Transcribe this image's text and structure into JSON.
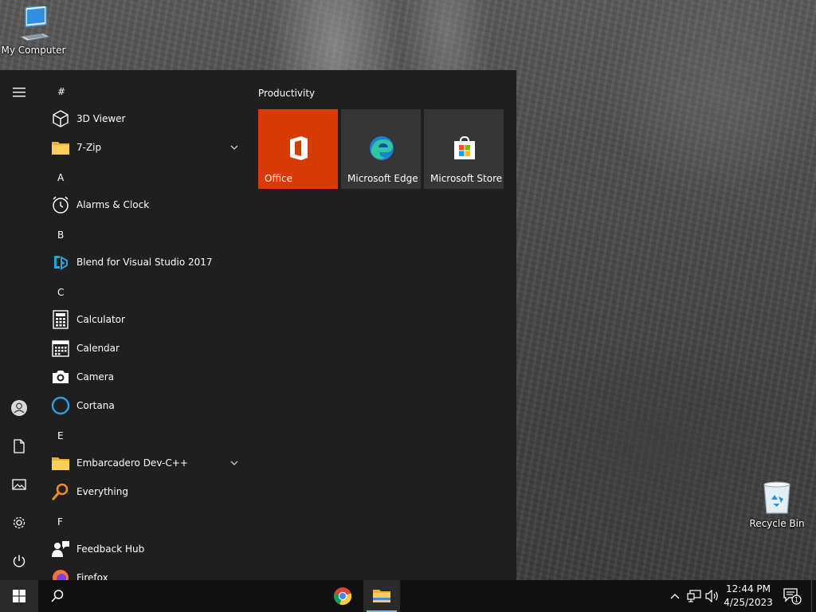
{
  "desktop": {
    "icons": [
      {
        "label": "My Computer",
        "icon": "computer-icon"
      },
      {
        "label": "Recycle Bin",
        "icon": "recycle-bin-icon"
      }
    ]
  },
  "start_menu": {
    "rail": [
      "hamburger-menu-icon",
      "user-account-icon",
      "documents-icon",
      "pictures-icon",
      "settings-gear-icon",
      "power-icon"
    ],
    "app_list": {
      "letters": [
        "#",
        "A",
        "B",
        "C",
        "E",
        "F"
      ],
      "apps": [
        {
          "label": "3D Viewer",
          "icon": "cube-3d-icon"
        },
        {
          "label": "7-Zip",
          "icon": "folder-icon",
          "expandable": true
        },
        {
          "label": "Alarms & Clock",
          "icon": "alarm-clock-icon"
        },
        {
          "label": "Blend for Visual Studio 2017",
          "icon": "blend-icon"
        },
        {
          "label": "Calculator",
          "icon": "calculator-icon"
        },
        {
          "label": "Calendar",
          "icon": "calendar-icon"
        },
        {
          "label": "Camera",
          "icon": "camera-icon"
        },
        {
          "label": "Cortana",
          "icon": "cortana-ring-icon"
        },
        {
          "label": "Embarcadero Dev-C++",
          "icon": "folder-icon",
          "expandable": true
        },
        {
          "label": "Everything",
          "icon": "magnifier-orange-icon"
        },
        {
          "label": "Feedback Hub",
          "icon": "feedback-person-icon"
        },
        {
          "label": "Firefox",
          "icon": "firefox-icon"
        }
      ]
    },
    "tiles": {
      "group_title": "Productivity",
      "items": [
        {
          "label": "Office",
          "icon": "office-logo-icon",
          "color": "#d83b01"
        },
        {
          "label": "Microsoft Edge",
          "icon": "edge-logo-icon",
          "color": "#363636"
        },
        {
          "label": "Microsoft Store",
          "icon": "store-bag-icon",
          "color": "#363636"
        }
      ]
    }
  },
  "taskbar": {
    "pinned": [
      "windows-start-icon",
      "search-icon",
      "chrome-icon",
      "file-explorer-icon"
    ],
    "tray": [
      "chevron-up-icon",
      "network-icon",
      "volume-icon"
    ],
    "clock": {
      "time": "12:44 PM",
      "date": "4/25/2023"
    },
    "notifications": {
      "count": "1"
    }
  },
  "colors": {
    "start_bg": "#1f1f1f",
    "taskbar_bg": "#101010",
    "tile_bg": "#363636",
    "office_orange": "#d83b01",
    "accent_blue": "#76b9ed"
  }
}
